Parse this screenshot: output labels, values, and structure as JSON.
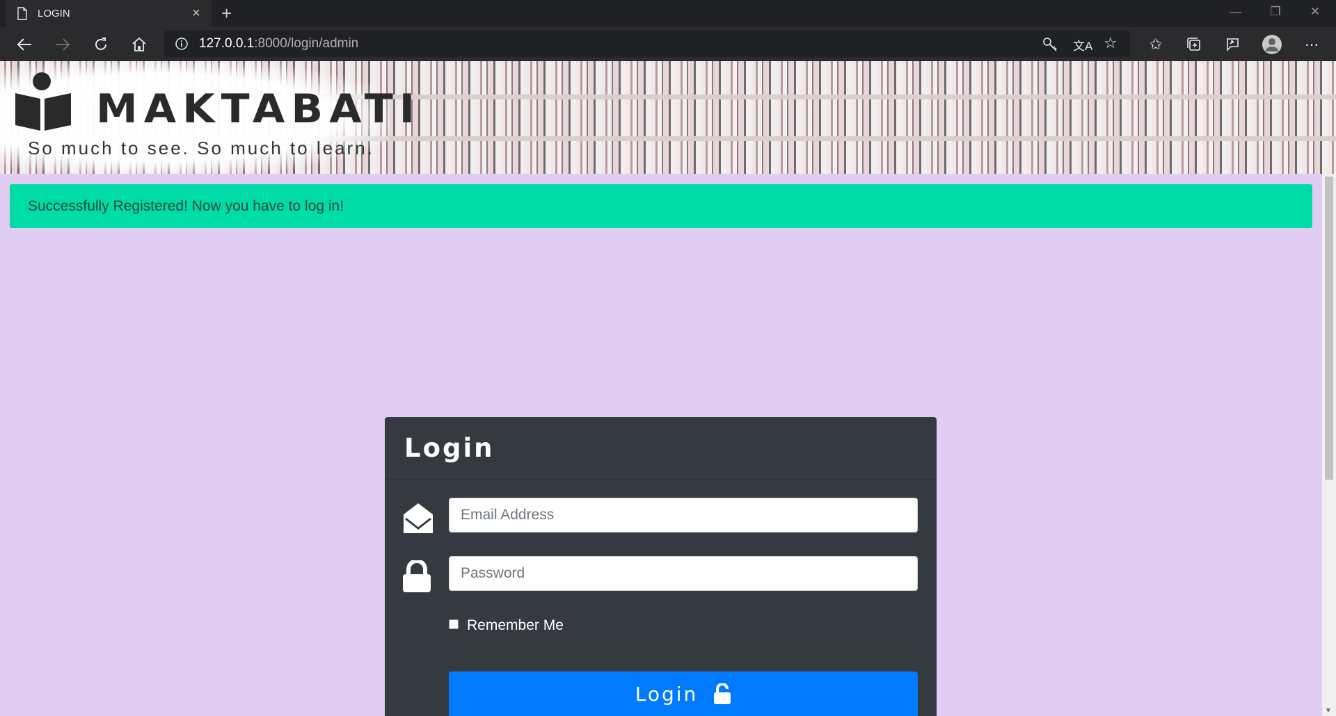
{
  "browser": {
    "tab_title": "LOGIN",
    "url_host": "127.0.0.1",
    "url_rest": ":8000/login/admin"
  },
  "banner": {
    "brand_name": "MAKTABATI",
    "tagline": "So much to see. So much to learn."
  },
  "alert": {
    "message": "Successfully Registered! Now you have to log in!"
  },
  "login_card": {
    "title": "Login",
    "email_placeholder": "Email Address",
    "password_placeholder": "Password",
    "remember_label": "Remember Me",
    "submit_label": "Login"
  },
  "colors": {
    "page_background": "#e1ccf3",
    "alert_background": "#00dca6",
    "card_background": "#343a40",
    "button_primary": "#007bff"
  },
  "icons": [
    "page-icon",
    "close-icon",
    "plus-icon",
    "back-icon",
    "forward-icon",
    "refresh-icon",
    "home-icon",
    "info-icon",
    "key-icon",
    "translate-icon",
    "star-icon",
    "favorites-icon",
    "collections-icon",
    "share-icon",
    "profile-icon",
    "more-icon",
    "reader-logo-icon",
    "envelope-icon",
    "lock-icon",
    "unlock-icon"
  ]
}
